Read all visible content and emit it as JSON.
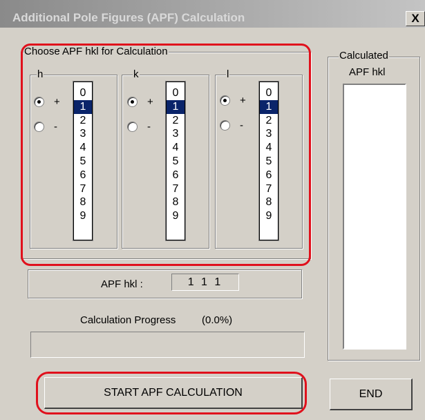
{
  "window": {
    "title": "Additional Pole Figures (APF) Calculation",
    "close_glyph": "X"
  },
  "choose_group": {
    "label": "Choose APF hkl for Calculation"
  },
  "index_groups": [
    {
      "label": "h",
      "plus_label": "+",
      "minus_label": "-",
      "sign_selected": "+",
      "items": [
        "0",
        "1",
        "2",
        "3",
        "4",
        "5",
        "6",
        "7",
        "8",
        "9"
      ],
      "selected_index": 1
    },
    {
      "label": "k",
      "plus_label": "+",
      "minus_label": "-",
      "sign_selected": "+",
      "items": [
        "0",
        "1",
        "2",
        "3",
        "4",
        "5",
        "6",
        "7",
        "8",
        "9"
      ],
      "selected_index": 1
    },
    {
      "label": "l",
      "plus_label": "+",
      "minus_label": "-",
      "sign_selected": "+",
      "items": [
        "0",
        "1",
        "2",
        "3",
        "4",
        "5",
        "6",
        "7",
        "8",
        "9"
      ],
      "selected_index": 1
    }
  ],
  "apf_hkl": {
    "label": "APF hkl :",
    "value": "1 1 1"
  },
  "progress": {
    "label": "Calculation Progress",
    "percent_text": "(0.0%)",
    "fraction": 0.0
  },
  "calculated_group": {
    "label_line1": "Calculated",
    "label_line2": "APF hkl",
    "items": []
  },
  "buttons": {
    "start_label": "START APF CALCULATION",
    "end_label": "END"
  },
  "colors": {
    "highlight": "#e0101c",
    "selection": "#0a246a",
    "dialog_face": "#d4d0c8"
  }
}
